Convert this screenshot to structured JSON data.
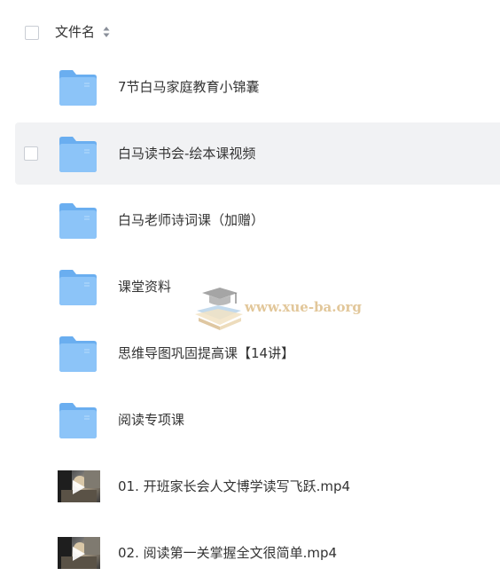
{
  "header": {
    "column_label": "文件名",
    "sort_icon": "sort-toggle-icon"
  },
  "files": [
    {
      "name": "7节白马家庭教育小锦囊",
      "type": "folder",
      "icon": "folder-icon"
    },
    {
      "name": "白马读书会-绘本课视频",
      "type": "folder",
      "icon": "folder-icon",
      "hovered": true
    },
    {
      "name": "白马老师诗词课（加赠）",
      "type": "folder",
      "icon": "folder-icon"
    },
    {
      "name": "课堂资料",
      "type": "folder",
      "icon": "folder-icon"
    },
    {
      "name": "思维导图巩固提高课【14讲】",
      "type": "folder",
      "icon": "folder-icon"
    },
    {
      "name": "阅读专项课",
      "type": "folder",
      "icon": "folder-icon"
    },
    {
      "name": "01. 开班家长会人文博学读写飞跃.mp4",
      "type": "video",
      "icon": "video-thumbnail"
    },
    {
      "name": "02. 阅读第一关掌握全文很简单.mp4",
      "type": "video",
      "icon": "video-thumbnail"
    }
  ],
  "watermark": {
    "text": "www.xue-ba.org",
    "icon": "graduation-cap-book-logo"
  },
  "colors": {
    "folder_blue": "#7cb8f5",
    "row_hover_bg": "#f1f2f4",
    "text": "#333333",
    "watermark": "#e2c79a"
  }
}
